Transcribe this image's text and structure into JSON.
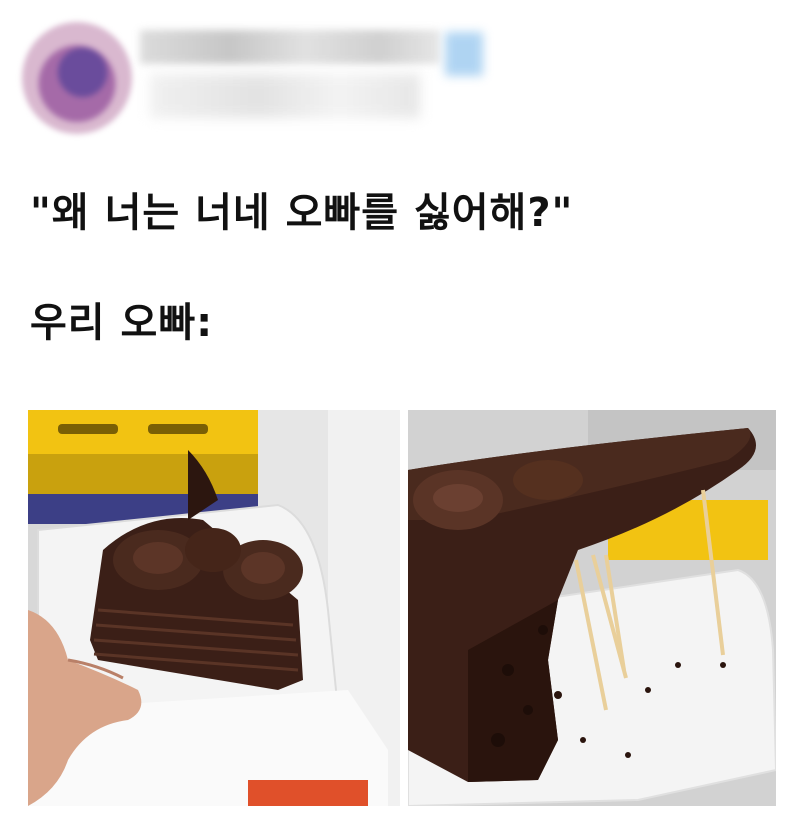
{
  "post": {
    "line1": "\"왜 너는 너네 오빠를 싫어해?\"",
    "line2": "우리 오빠:"
  },
  "colors": {
    "chocolate": "#3b1f17",
    "chocolate_light": "#5a3426",
    "plate": "#f4f4f4",
    "toothpick": "#e9cf9a",
    "crate_yellow": "#f2c312"
  }
}
